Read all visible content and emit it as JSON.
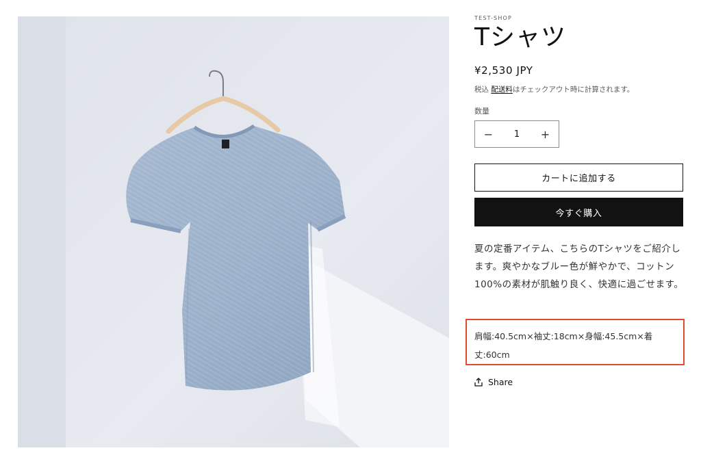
{
  "product": {
    "vendor": "TEST-SHOP",
    "title": "Tシャツ",
    "price": "¥2,530 JPY",
    "tax_prefix": "税込 ",
    "shipping_link": "配送料",
    "tax_suffix": "はチェックアウト時に計算されます。",
    "quantity_label": "数量",
    "quantity_value": "1",
    "decrease_symbol": "−",
    "increase_symbol": "+",
    "add_to_cart": "カートに追加する",
    "buy_now": "今すぐ購入",
    "description": "夏の定番アイテム、こちらのTシャツをご紹介します。爽やかなブルー色が鮮やかで、コットン100%の素材が肌触り良く、快適に過ごせます。",
    "sizes": "肩幅:40.5cm×袖丈:18cm×身幅:45.5cm×着丈:60cm",
    "share_label": "Share"
  },
  "colors": {
    "accent_highlight": "#e04a2f",
    "buy_button_bg": "#121212",
    "shirt": "#9fb3cc"
  },
  "icons": {
    "share": "share-icon",
    "product_image": "t-shirt-on-hanger"
  }
}
